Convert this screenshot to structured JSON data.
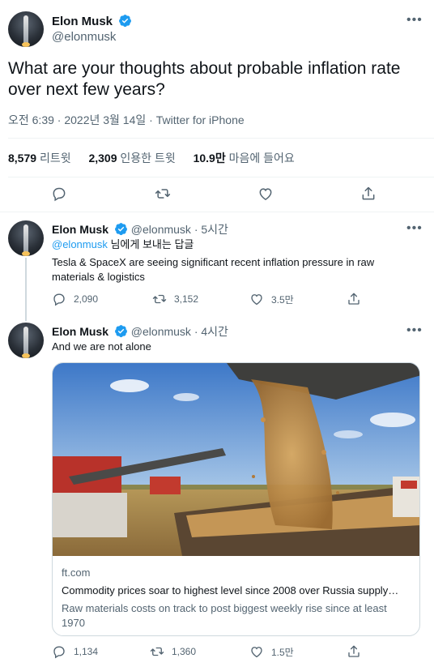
{
  "main_tweet": {
    "name": "Elon Musk",
    "handle": "@elonmusk",
    "text": "What are your thoughts about probable inflation rate over next few years?",
    "timestamp": "오전 6:39 · 2022년 3월 14일 · Twitter for iPhone",
    "stats": {
      "retweets_count": "8,579",
      "retweets_label": "리트윗",
      "quotes_count": "2,309",
      "quotes_label": "인용한 트윗",
      "likes_count": "10.9만",
      "likes_label": "마음에 들어요"
    }
  },
  "reply1": {
    "name": "Elon Musk",
    "handle": "@elonmusk",
    "time": "· 5시간",
    "reply_to_handle": "@elonmusk",
    "reply_to_suffix": " 님에게 보내는 답글",
    "text": "Tesla & SpaceX are seeing significant recent inflation pressure in raw materials & logistics",
    "replies": "2,090",
    "retweets": "3,152",
    "likes": "3.5만"
  },
  "reply2": {
    "name": "Elon Musk",
    "handle": "@elonmusk",
    "time": "· 4시간",
    "text": "And we are not alone",
    "card": {
      "domain": "ft.com",
      "title": "Commodity prices soar to highest level since 2008 over Russia supply…",
      "description": "Raw materials costs on track to post biggest weekly rise since at least 1970"
    },
    "replies": "1,134",
    "retweets": "1,360",
    "likes": "1.5만"
  },
  "colors": {
    "accent": "#1d9bf0",
    "text": "#0f1419",
    "muted": "#536471",
    "border": "#cfd9de"
  },
  "icons": [
    "verified-badge-icon",
    "more-icon",
    "reply-icon",
    "retweet-icon",
    "like-icon",
    "share-icon"
  ]
}
